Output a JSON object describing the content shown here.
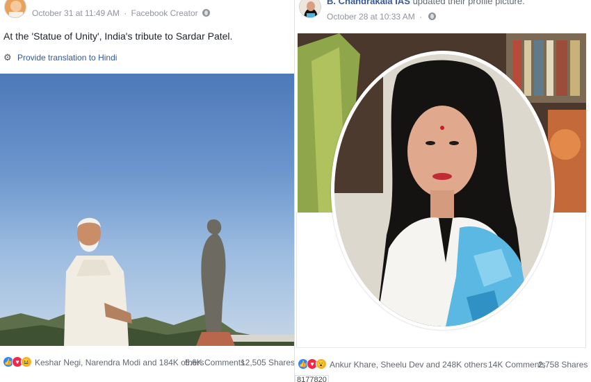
{
  "left_post": {
    "timestamp": "October 31 at 11:49 AM",
    "separator": "·",
    "audience": "Facebook Creator",
    "audience_icon": "globe-icon",
    "text": "At the 'Statue of Unity', India's tribute to Sardar Patel.",
    "translate_label": "Provide translation to Hindi",
    "reaction_icons": [
      "like-icon",
      "love-icon",
      "haha-icon"
    ],
    "reactions_text": "Keshar Negi, Narendra Modi and 184K others",
    "comments": "5.6K Comments",
    "shares": "12,505 Shares"
  },
  "right_post": {
    "author": "B. Chandrakala IAS",
    "action": "updated their profile picture.",
    "timestamp": "October 28 at 10:33 AM",
    "separator": "·",
    "audience_icon": "globe-icon",
    "reaction_icons": [
      "like-icon",
      "love-icon",
      "wow-icon"
    ],
    "reactions_text": "Ankur Khare, Sheelu Dev and 248K others",
    "comments": "14K Comments",
    "shares": "2,758 Shares"
  },
  "overlay_text": "8177820",
  "colors": {
    "link": "#365899",
    "meta": "#90949c",
    "like": "#2d88ff",
    "love": "#f0284a",
    "wow": "#f7b125",
    "sky": "#6b95cc"
  }
}
